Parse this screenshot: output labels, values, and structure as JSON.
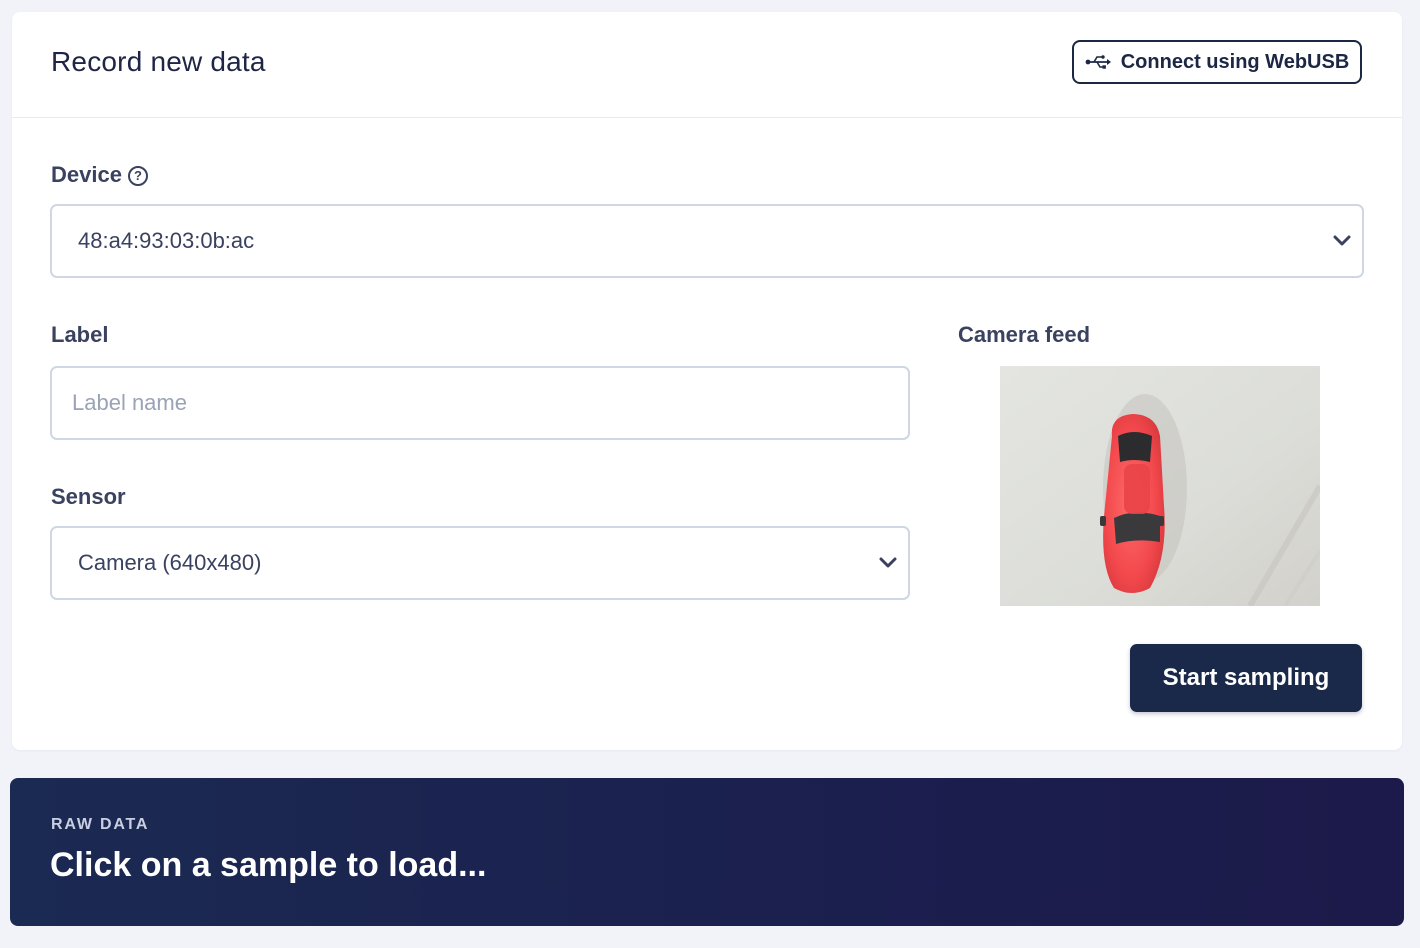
{
  "header": {
    "title": "Record new data",
    "connect_button_label": "Connect using WebUSB",
    "connect_button_icon": "usb-icon"
  },
  "device": {
    "label": "Device",
    "help_icon": "help-icon",
    "selected_value": "48:a4:93:03:0b:ac"
  },
  "label_field": {
    "label": "Label",
    "value": "",
    "placeholder": "Label name"
  },
  "sensor": {
    "label": "Sensor",
    "selected_value": "Camera (640x480)"
  },
  "camera": {
    "label": "Camera feed"
  },
  "actions": {
    "start_label": "Start sampling"
  },
  "raw_data": {
    "caption": "RAW DATA",
    "message": "Click on a sample to load..."
  },
  "colors": {
    "page_background": "#f1f3f9",
    "primary_dark": "#1a2849",
    "input_border": "#cfd6e4",
    "raw_panel": "#1b2a52"
  }
}
